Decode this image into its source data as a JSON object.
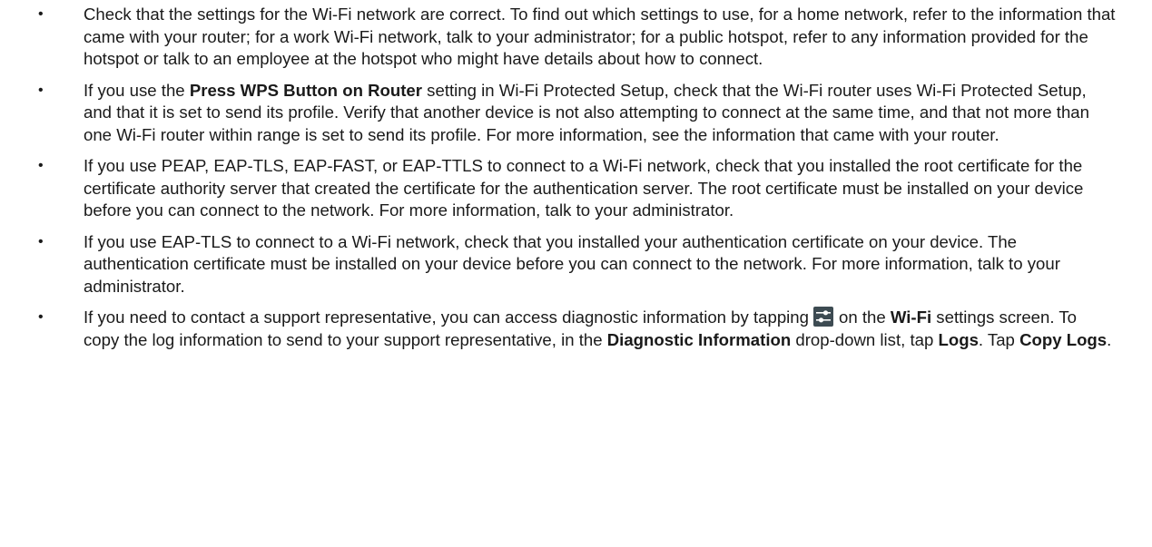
{
  "bullet_glyph": "•",
  "items": [
    {
      "text": "Check that the settings for the Wi-Fi network are correct. To find out which settings to use, for a home network, refer to the information that came with your router; for a work Wi-Fi network, talk to your administrator; for a public hotspot, refer to any information provided for the hotspot or talk to an employee at the hotspot who might have details about how to connect."
    },
    {
      "pre": "If you use the ",
      "bold": "Press WPS Button on Router",
      "post": " setting in Wi-Fi Protected Setup, check that the Wi-Fi router uses Wi-Fi Protected Setup, and that it is set to send its profile. Verify that another device is not also attempting to connect at the same time, and that not more than one Wi-Fi router within range is set to send its profile. For more information, see the information that came with your router."
    },
    {
      "text": "If you use PEAP, EAP-TLS, EAP-FAST, or EAP-TTLS to connect to a Wi-Fi network, check that you installed the root certificate for the certificate authority server that created the certificate for the authentication server. The root certificate must be installed on your device before you can connect to the network. For more information, talk to your administrator."
    },
    {
      "text": "If you use EAP-TLS to connect to a Wi-Fi network, check that you installed your authentication certificate on your device. The authentication certificate must be installed on your device before you can connect to the network. For more information, talk to your administrator."
    },
    {
      "p1": "If you need to contact a support representative, you can access diagnostic information by tapping",
      "icon": "settings-sliders-icon",
      "p2": "on the ",
      "b1": "Wi-Fi",
      "p3": " settings screen. To copy the log information to send to your support representative, in the ",
      "b2": "Diagnostic Information",
      "p4": " drop-down list, tap ",
      "b3": "Logs",
      "p5": ". Tap ",
      "b4": "Copy Logs",
      "p6": "."
    }
  ]
}
